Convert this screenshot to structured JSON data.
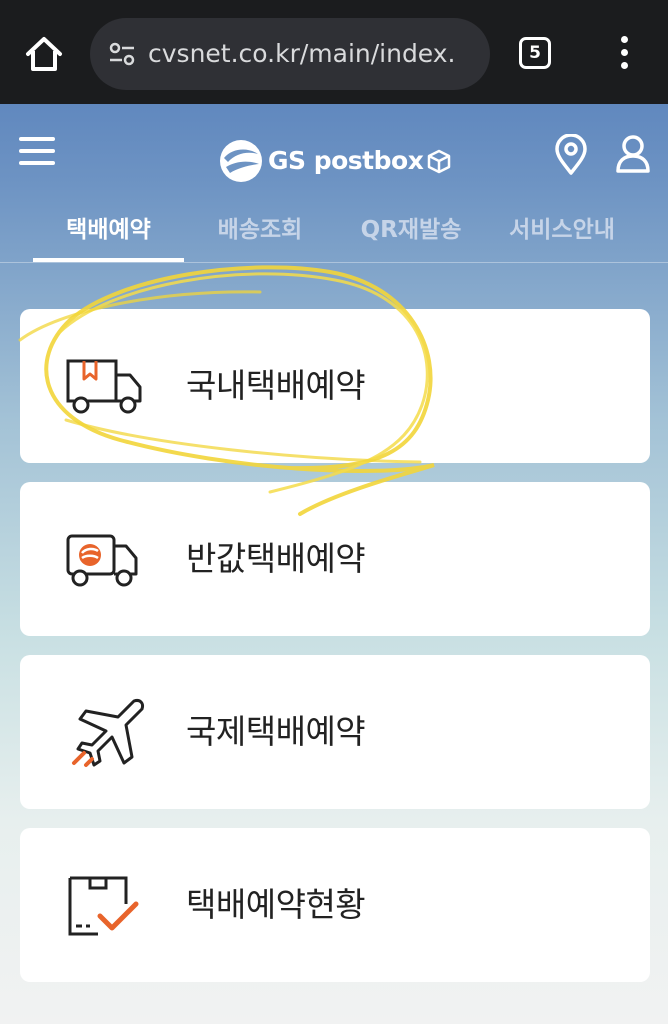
{
  "browser": {
    "url": "cvsnet.co.kr/main/index.",
    "tab_count": "5",
    "home_icon": "home-icon",
    "site_settings_icon": "tune-icon",
    "menu_icon": "more-vert-icon"
  },
  "header": {
    "logo_text": "GS postbox",
    "menu_icon": "hamburger-icon",
    "location_icon": "map-pin-icon",
    "account_icon": "user-icon"
  },
  "nav": {
    "tabs": [
      {
        "label": "택배예약",
        "active": true
      },
      {
        "label": "배송조회",
        "active": false
      },
      {
        "label": "QR재발송",
        "active": false
      },
      {
        "label": "서비스안내",
        "active": false
      }
    ]
  },
  "menu_cards": [
    {
      "label": "국내택배예약",
      "icon": "delivery-truck-icon",
      "highlighted": true
    },
    {
      "label": "반값택배예약",
      "icon": "half-price-truck-icon",
      "highlighted": false
    },
    {
      "label": "국제택배예약",
      "icon": "airplane-icon",
      "highlighted": false
    },
    {
      "label": "택배예약현황",
      "icon": "box-checklist-icon",
      "highlighted": false
    }
  ],
  "colors": {
    "accent": "#e8642b",
    "header_blue": "#4f79b8",
    "highlight_marker": "#f2d53a"
  }
}
